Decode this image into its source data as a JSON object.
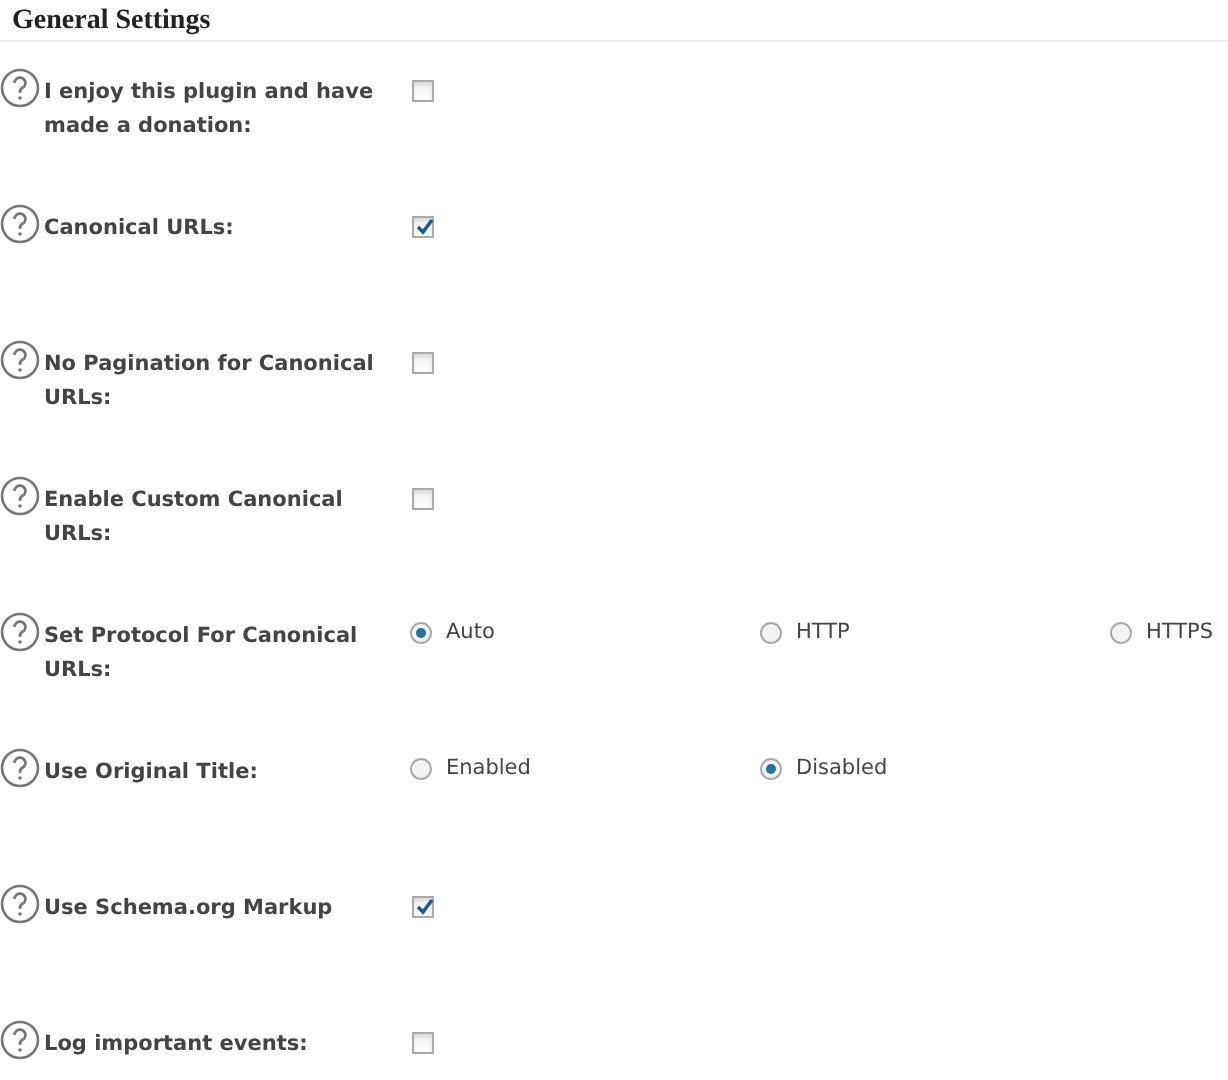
{
  "title": "General Settings",
  "settings": [
    {
      "label": "I enjoy this plugin and have made a donation:",
      "kind": "checkbox",
      "checked": false
    },
    {
      "label": "Canonical URLs:",
      "kind": "checkbox",
      "checked": true
    },
    {
      "label": "No Pagination for Canonical URLs:",
      "kind": "checkbox",
      "checked": false
    },
    {
      "label": "Enable Custom Canonical URLs:",
      "kind": "checkbox",
      "checked": false
    },
    {
      "label": "Set Protocol For Canonical URLs:",
      "kind": "radio",
      "options": [
        {
          "label": "Auto",
          "selected": true
        },
        {
          "label": "HTTP",
          "selected": false
        },
        {
          "label": "HTTPS",
          "selected": false
        }
      ]
    },
    {
      "label": "Use Original Title:",
      "kind": "radio",
      "options": [
        {
          "label": "Enabled",
          "selected": false
        },
        {
          "label": "Disabled",
          "selected": true
        }
      ]
    },
    {
      "label": "Use Schema.org Markup",
      "kind": "checkbox",
      "checked": true
    },
    {
      "label": "Log important events:",
      "kind": "checkbox",
      "checked": false
    }
  ]
}
